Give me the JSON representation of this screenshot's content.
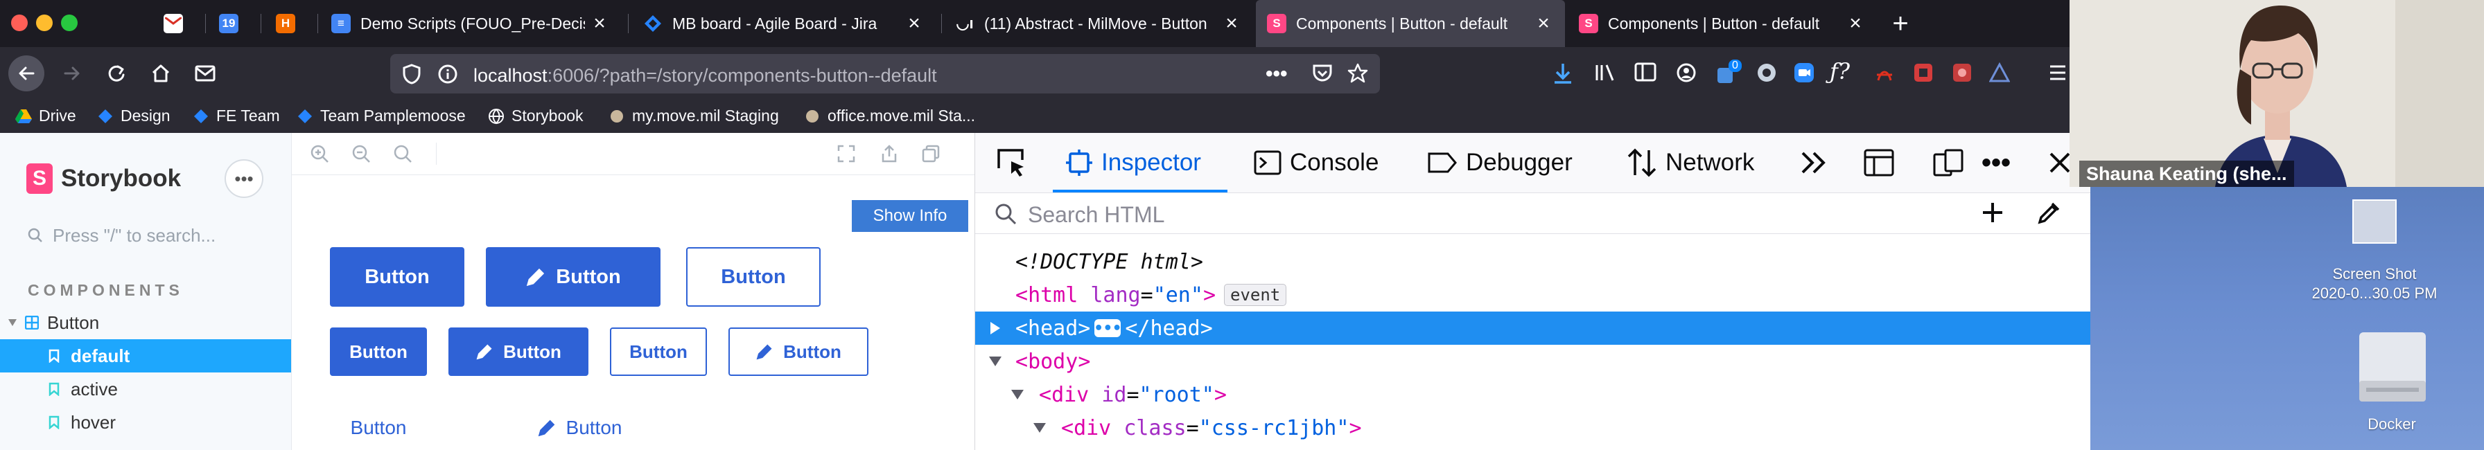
{
  "browser": {
    "tabs": [
      {
        "title": "",
        "icon": "gmail-icon",
        "color": "#d93025"
      },
      {
        "title": "",
        "icon": "calendar-icon",
        "color": "#4285f4"
      },
      {
        "title": "",
        "icon": "harvest-icon",
        "color": "#f36c00"
      },
      {
        "title": "Demo Scripts (FOUO_Pre-Decis",
        "icon": "docs-icon",
        "color": "#4285f4"
      },
      {
        "title": "MB board - Agile Board - Jira",
        "icon": "jira-icon",
        "color": "#2684ff"
      },
      {
        "title": "(11) Abstract - MilMove - Button",
        "icon": "abstract-icon",
        "color": "#ffffff"
      },
      {
        "title": "Components | Button - default",
        "icon": "storybook-icon",
        "color": "#ff4785"
      },
      {
        "title": "Components | Button - default",
        "icon": "storybook-icon",
        "color": "#ff4785"
      }
    ],
    "url": {
      "host": "localhost",
      "rest": ":6006/?path=/story/components-button--default"
    },
    "bookmarks": [
      "Drive",
      "Design",
      "FE Team",
      "Team Pamplemoose",
      "Storybook",
      "my.move.mil Staging",
      "office.move.mil Sta..."
    ],
    "toolbar_badge": "0"
  },
  "storybook": {
    "logo": "Storybook",
    "search_placeholder": "Press \"/\" to search...",
    "section": "COMPONENTS",
    "component": "Button",
    "stories": [
      "default",
      "active",
      "hover"
    ],
    "selected_story": "default",
    "show_info": "Show Info",
    "button_label": "Button"
  },
  "devtools": {
    "tabs": [
      "Inspector",
      "Console",
      "Debugger",
      "Network"
    ],
    "active_tab": "Inspector",
    "search_placeholder": "Search HTML",
    "lines": {
      "doctype": "<!DOCTYPE html>",
      "html_tag": "html",
      "html_attr": "lang",
      "html_val": "\"en\"",
      "event_badge": "event",
      "head_open": "<head>",
      "head_close": "</head>",
      "body": "body",
      "div": "div",
      "div_attr_id": "id",
      "div_id_val": "\"root\"",
      "div_attr_class": "class",
      "div_class_val": "\"css-rc1jbh\""
    }
  },
  "video": {
    "participant": "Shauna Keating (she...",
    "desktop_files": [
      {
        "label1": "Screen Shot",
        "label2": "2020-0...30.05 PM"
      },
      {
        "label1": "Docker",
        "label2": ""
      }
    ]
  }
}
